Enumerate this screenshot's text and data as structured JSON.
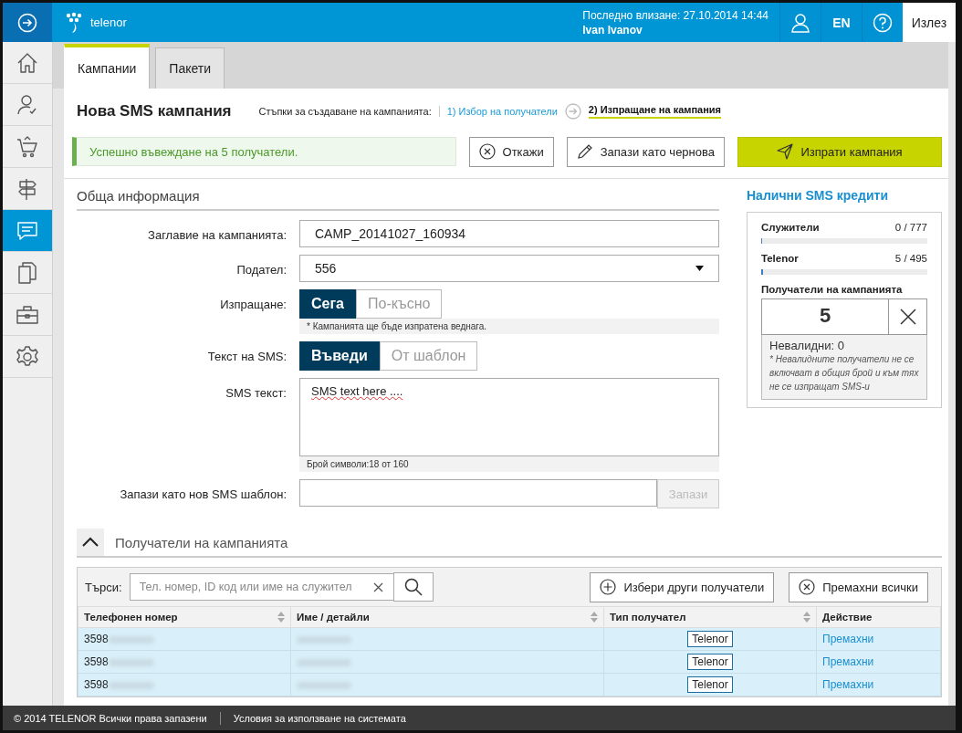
{
  "header": {
    "logo": "telenor",
    "last_login": "Последно влизане: 27.10.2014 14:44",
    "user": "Ivan Ivanov",
    "language": "EN",
    "logout": "Излез"
  },
  "sidebar": {
    "items": [
      {
        "kind": "home",
        "selected": false
      },
      {
        "kind": "user",
        "selected": false
      },
      {
        "kind": "cart",
        "selected": false
      },
      {
        "kind": "signpost",
        "selected": false
      },
      {
        "kind": "chat",
        "selected": true
      },
      {
        "kind": "documents",
        "selected": false
      },
      {
        "kind": "briefcase",
        "selected": false
      },
      {
        "kind": "gear",
        "selected": false
      }
    ]
  },
  "tabs": [
    {
      "label": "Кампании",
      "selected": true
    },
    {
      "label": "Пакети",
      "selected": false
    }
  ],
  "page_title": "Нова SMS кампания",
  "steps": {
    "label": "Стъпки за създаване на кампанията:",
    "items": [
      {
        "label": "1) Избор на получатели",
        "selected": false
      },
      {
        "label": "2) Изпращане на кампания",
        "selected": true
      }
    ]
  },
  "alert": "Успешно въвеждане на 5 получатели.",
  "actions": {
    "cancel": "Откажи",
    "draft": "Запази като чернова",
    "send": "Изпрати кампания"
  },
  "general": {
    "heading": "Обща информация",
    "fields": [
      {
        "kind": "text",
        "label": "Заглавие на кампанията:",
        "value": "CAMP_20141027_160934"
      },
      {
        "kind": "select",
        "label": "Подател:",
        "value": "556"
      },
      {
        "kind": "toggle",
        "label": "Изпращане:",
        "options": [
          {
            "label": "Сега",
            "selected": true
          },
          {
            "label": "По-късно",
            "selected": false
          }
        ],
        "hint": "* Кампанията ще бъде изпратена веднага."
      },
      {
        "kind": "toggle",
        "label": "Текст на SMS:",
        "options": [
          {
            "label": "Въведи",
            "selected": true
          },
          {
            "label": "От шаблон",
            "selected": false
          }
        ]
      },
      {
        "kind": "textarea",
        "label": "SMS текст:",
        "value": "SMS text here ....",
        "hint": "Брой символи:18 от 160"
      },
      {
        "kind": "input_button",
        "label": "Запази като нов SMS шаблон:",
        "button": "Запази",
        "disabled": true
      }
    ]
  },
  "credits": {
    "title": "Налични SMS кредити",
    "meters": [
      {
        "label": "Служители",
        "reading": "0 / 777",
        "level": 0
      },
      {
        "label": "Telenor",
        "reading": "5 / 495",
        "level": 0.01
      }
    ],
    "recipients_label": "Получатели на кампанията",
    "count": "5",
    "invalid": "Невалидни: 0",
    "note": "* Невалидните получатели не се включват в общия брой и към тях не се изпращат SMS-и"
  },
  "recipients": {
    "heading": "Получатели на кампанията",
    "expanded": true,
    "search_label": "Търси:",
    "search_placeholder": "Тел. номер, ID код или име на служител",
    "add": "Избери други получатели",
    "remove_all": "Премахни всички",
    "columns": [
      {
        "label": "Телефонен номер",
        "sortable": true
      },
      {
        "label": "Име / детайли",
        "sortable": true
      },
      {
        "label": "Тип получател",
        "sortable": true
      },
      {
        "label": "Действие",
        "sortable": false
      }
    ],
    "rows": [
      {
        "phone": "3598",
        "type": "Telenor",
        "action": "Премахни",
        "selected": true
      },
      {
        "phone": "3598",
        "type": "Telenor",
        "action": "Премахни",
        "selected": true
      },
      {
        "phone": "3598",
        "type": "Telenor",
        "action": "Премахни",
        "selected": true
      }
    ]
  },
  "footer": {
    "copyright": "© 2014 TELENOR Всички права запазени",
    "terms": "Условия за използване на системата"
  }
}
